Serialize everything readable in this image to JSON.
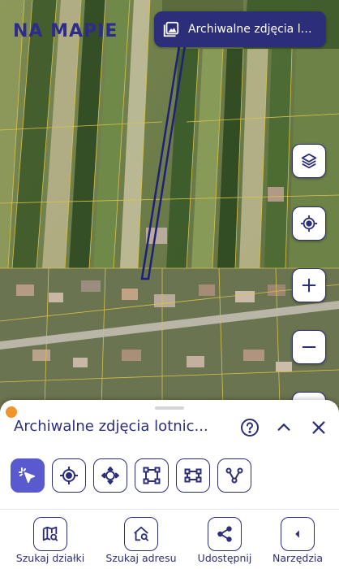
{
  "logo": {
    "text": "NA MAPIE",
    "display": "NA MAPIE"
  },
  "map": {
    "imagery_chip_label": "Archiwalne zdjęcia lotnic...",
    "buttons": [
      "layers-icon",
      "locate-icon",
      "zoom-in-icon",
      "zoom-out-icon"
    ]
  },
  "sheet": {
    "title": "Archiwalne zdjęcia lotnic...",
    "tools": [
      "select-tool",
      "point-tool",
      "pan-tool",
      "rectangle-tool",
      "polygon-tool",
      "polyline-tool"
    ]
  },
  "bottom_nav": {
    "items": [
      {
        "label": "Szukaj działki",
        "icon": "map-search-icon"
      },
      {
        "label": "Szukaj adresu",
        "icon": "home-search-icon"
      },
      {
        "label": "Udostępnij",
        "icon": "share-icon"
      },
      {
        "label": "Narzędzia",
        "icon": "back-icon"
      }
    ]
  },
  "colors": {
    "brand": "#2c2e7a",
    "active_tool": "#5a5acf",
    "accent_dot": "#f0952a",
    "highlight_line": "#1f1f7a",
    "parcel_lines": "#d9c24a"
  }
}
